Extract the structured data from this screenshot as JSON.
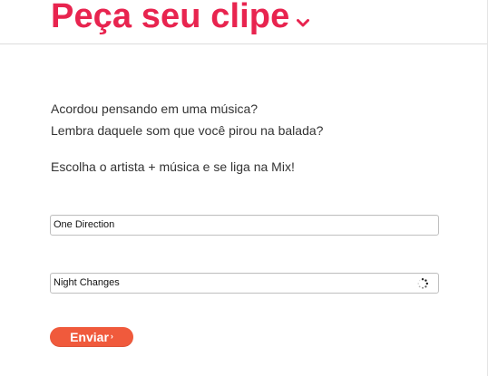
{
  "header": {
    "title": "Peça seu clipe",
    "title_color": "#e8244f",
    "dropdown_icon": "chevron-down-icon"
  },
  "intro": {
    "line1": "Acordou pensando em uma música?",
    "line2": "Lembra daquele som que você pirou na balada?",
    "line3": "Escolha o artista + música e se liga na Mix!"
  },
  "form": {
    "artist": {
      "value": "One Direction",
      "placeholder": ""
    },
    "song": {
      "value": "Night Changes",
      "placeholder": "",
      "status_icon": "loading-spinner-icon"
    },
    "submit": {
      "label": "Enviar",
      "arrow": "›",
      "color": "#f05a3c"
    }
  }
}
